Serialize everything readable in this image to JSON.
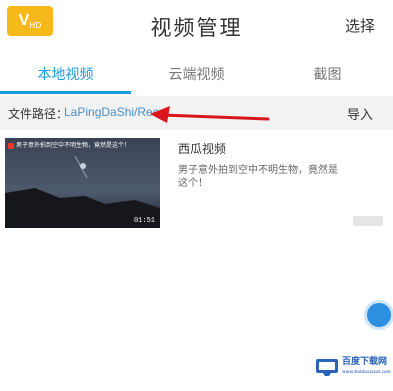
{
  "header": {
    "logo_text": "V",
    "logo_sub": "HD",
    "title": "视频管理",
    "select_label": "选择"
  },
  "tabs": [
    {
      "label": "本地视频",
      "active": true
    },
    {
      "label": "云端视频",
      "active": false
    },
    {
      "label": "截图",
      "active": false
    }
  ],
  "path_bar": {
    "label": "文件路径：",
    "value": "LaPingDaShi/Rec",
    "import_label": "导入"
  },
  "videos": [
    {
      "thumbnail_caption": "男子意外拍到空中不明生物，竟然是这个！",
      "duration": "01:51",
      "title": "西瓜视频",
      "description": "男子意外拍到空中不明生物，竟然是这个！"
    }
  ],
  "watermark": {
    "text": "百度下载网",
    "sub": "www.baiduxiazai.com"
  },
  "colors": {
    "accent": "#1a9be0",
    "logo": "#f6b91a",
    "arrow": "#d9161c",
    "path_text": "#4a90c9"
  }
}
